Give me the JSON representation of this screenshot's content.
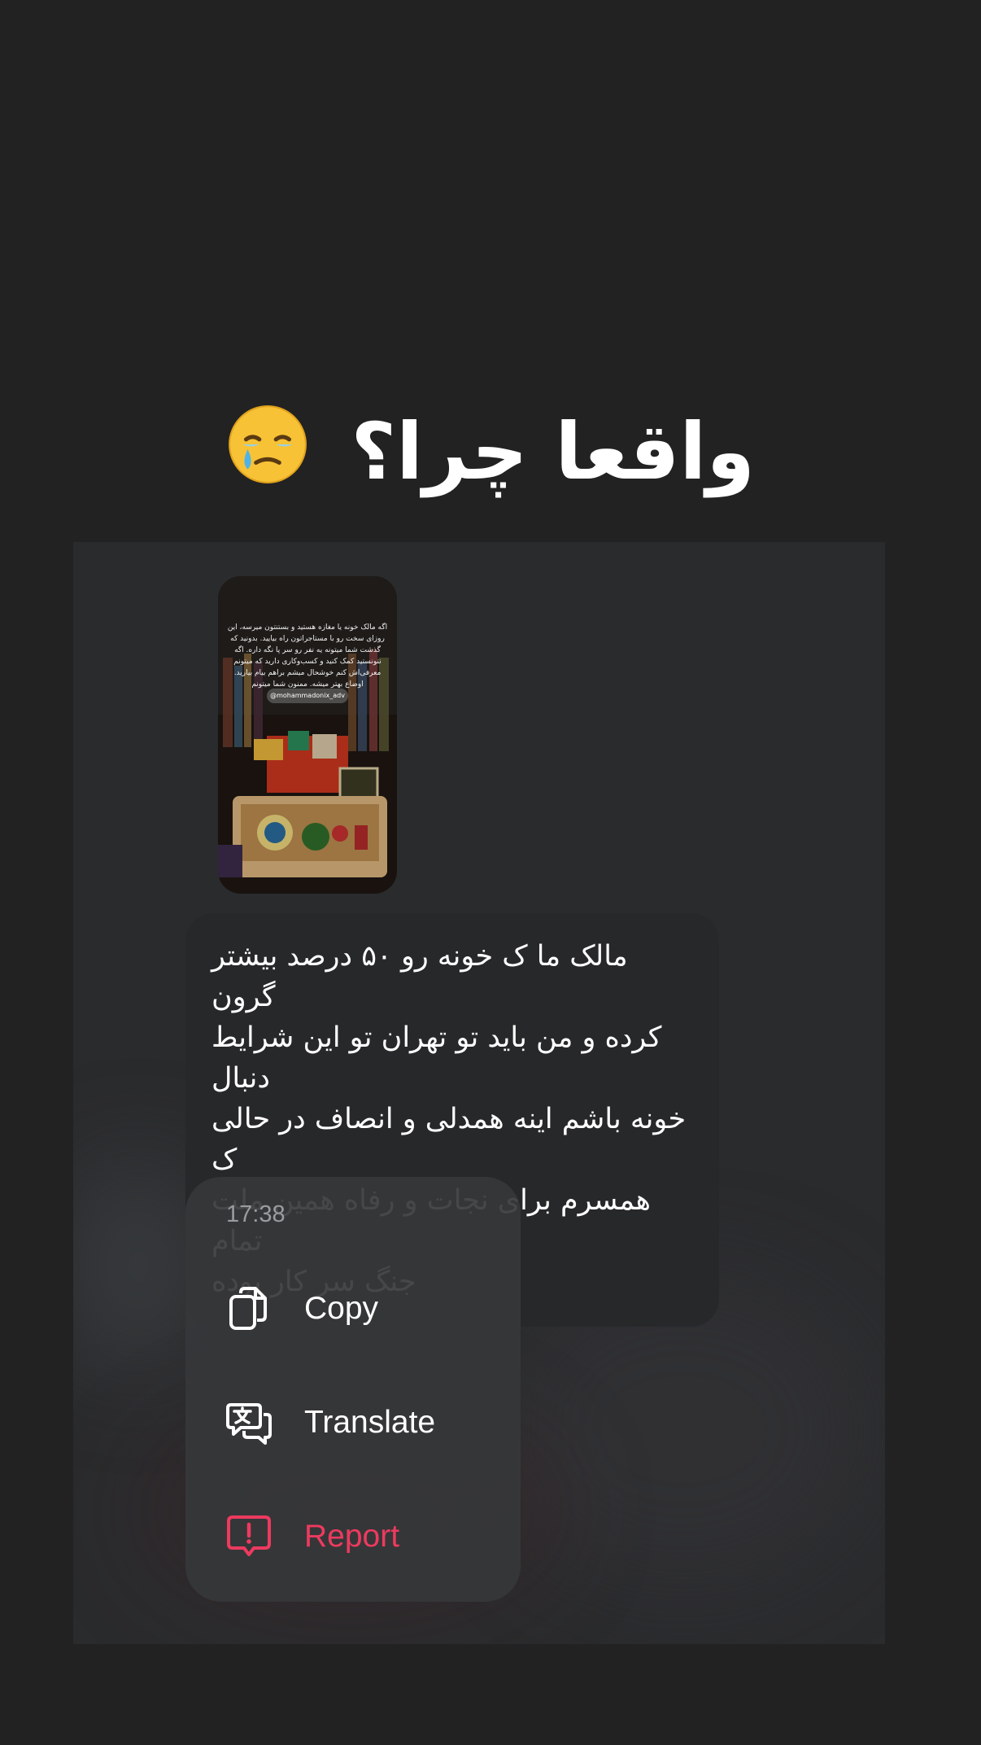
{
  "headline": {
    "text": "واقعا چرا؟",
    "emoji": "face-holding-back-tears"
  },
  "story": {
    "overlay_text": "اگه مالک خونه یا مغازه هستید و بستنتون میرسه، این روزای سخت رو با مستاجراتون راه بیایید. بدونید که گذشت شما میتونه یه نفر رو سر پا نگه داره. اگه نتونستید کمک کنید و کسب‌وکاری دارید که میتونم معرفی‌اش کنم خوشحال میشم براهم بیام بیارید. اوضاع بهتر میشه. ممنون شما میتونم",
    "username": "@mohammadonix_adv"
  },
  "message": {
    "text": "مالک ما ک خونه رو ۵۰ درصد بیشتر گرون\nکرده و من باید تو تهران تو این شرایط دنبال\nخونه باشم اینه همدلی و انصاف در حالی ک\nهمسرم برای نجات و رفاه همین ملت تمام\nجنگ سر کار بوده"
  },
  "menu": {
    "time": "17:38",
    "items": [
      {
        "label": "Copy",
        "icon": "copy-icon"
      },
      {
        "label": "Translate",
        "icon": "translate-icon"
      },
      {
        "label": "Report",
        "icon": "report-icon"
      }
    ]
  },
  "colors": {
    "page_background": "#222223",
    "screenshot_background": "#2a2b2d",
    "menu_background": "#36373a",
    "report_accent": "#ed3a5f",
    "timestamp": "#9b9ca0"
  }
}
